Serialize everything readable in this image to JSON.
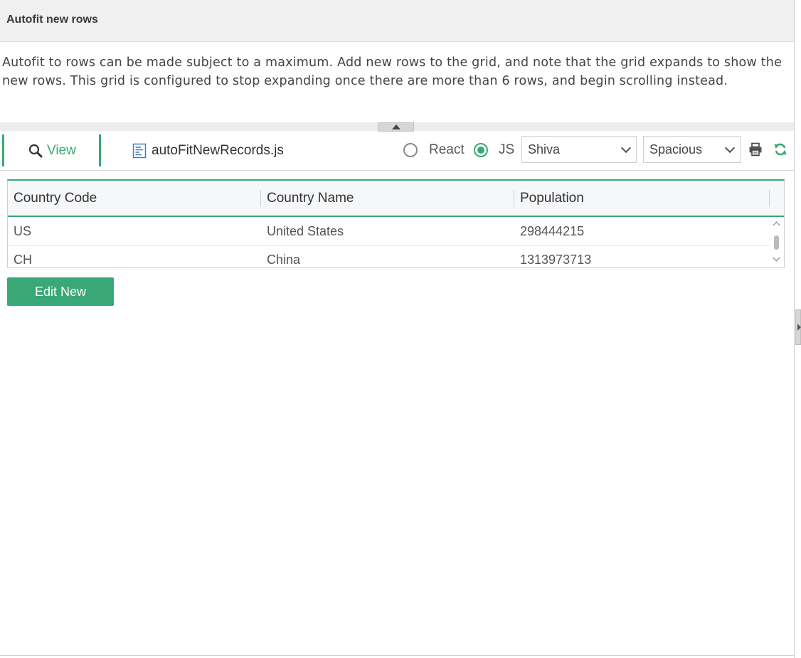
{
  "header": {
    "title": "Autofit new rows"
  },
  "description": "Autofit to rows can be made subject to a maximum. Add new rows to the grid, and note that the grid expands to show the new rows. This grid is configured to stop expanding once there are more than 6 rows, and begin scrolling instead.",
  "toolbar": {
    "tabs": [
      {
        "label": "View",
        "icon": "search-icon",
        "active": true
      },
      {
        "label": "autoFitNewRecords.js",
        "icon": "file-icon",
        "active": false
      }
    ],
    "framework_options": [
      {
        "label": "React",
        "checked": false
      },
      {
        "label": "JS",
        "checked": true
      }
    ],
    "skin_select": {
      "value": "Shiva"
    },
    "density_select": {
      "value": "Spacious"
    },
    "icons": [
      "print-icon",
      "refresh-icon"
    ],
    "accent_color": "#3aa876"
  },
  "grid": {
    "columns": [
      "Country Code",
      "Country Name",
      "Population"
    ],
    "rows": [
      [
        "US",
        "United States",
        "298444215"
      ],
      [
        "CH",
        "China",
        "1313973713"
      ]
    ]
  },
  "edit_button": {
    "label": "Edit New"
  }
}
